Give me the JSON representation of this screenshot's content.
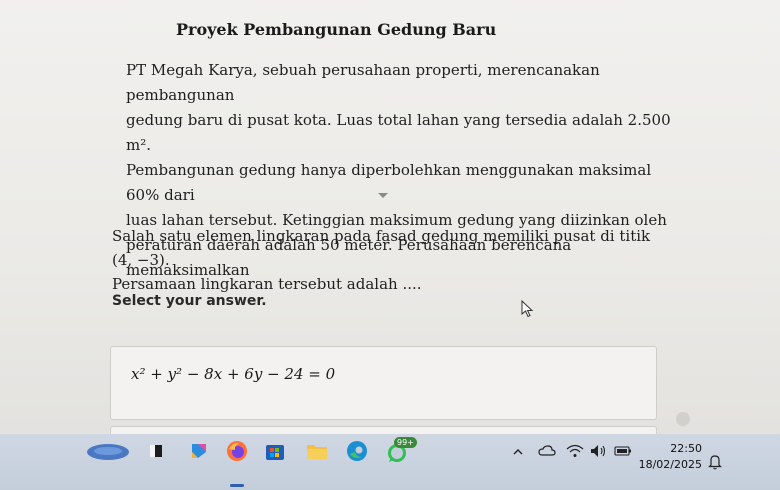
{
  "content": {
    "title": "Proyek Pembangunan Gedung Baru",
    "paragraph_lines": [
      "PT Megah Karya, sebuah perusahaan properti, merencanakan pembangunan",
      "gedung baru di pusat kota. Luas total lahan yang tersedia adalah 2.500 m².",
      "Pembangunan gedung hanya diperbolehkan menggunakan maksimal 60% dari",
      "luas lahan tersebut. Ketinggian maksimum gedung yang diizinkan oleh",
      "peraturan daerah adalah 50 meter. Perusahaan berencana memaksimalkan"
    ],
    "question_lines": [
      "Salah satu elemen lingkaran pada fasad gedung memiliki pusat di titik (4, −3).",
      "Persamaan lingkaran tersebut adalah ...."
    ],
    "prompt": "Select your answer.",
    "options": [
      {
        "label": "x² + y² − 8x + 6y − 24 = 0"
      }
    ]
  },
  "taskbar": {
    "time": "22:50",
    "date": "18/02/2025",
    "notification_badge": "99+",
    "icons": [
      "widgets-icon",
      "files-icon",
      "copilot-icon",
      "firefox-icon",
      "store-icon",
      "folder-icon",
      "edge-icon",
      "whatsapp-icon"
    ],
    "tray_icons": [
      "chevron-up-icon",
      "cloud-icon",
      "wifi-icon",
      "speaker-icon",
      "battery-icon",
      "bell-icon"
    ]
  }
}
